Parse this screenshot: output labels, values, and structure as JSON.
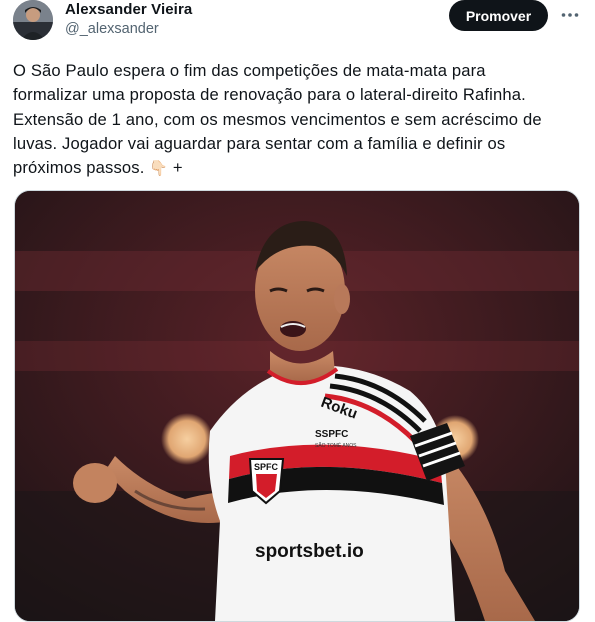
{
  "author": {
    "name": "Alexsander Vieira",
    "handle": "@_alexsander"
  },
  "actions": {
    "promote_label": "Promover",
    "more_icon": "more-horizontal-icon"
  },
  "tweet": {
    "text_lines": [
      "O São Paulo espera o fim das competições de mata-mata para",
      "formalizar uma proposta de renovação para o lateral-direito Rafinha.",
      "Extensão de 1 ano, com os mesmos vencimentos e sem acréscimo de",
      "luvas. Jogador vai aguardar para sentar com a família e definir os"
    ],
    "last_line": "próximos passos.",
    "emoji": "👇🏻",
    "plus": "+"
  },
  "media": {
    "jersey_sponsor": "sportsbet.io",
    "jersey_sleeve": "Roku",
    "jersey_crest": "SPFC",
    "jersey_patch": "SSPFC",
    "jersey_patch_sub": "SÃO TOMÉ ANOS"
  },
  "colors": {
    "text": "#0f1419",
    "secondary": "#536471",
    "button_bg": "#0f1419",
    "button_text": "#ffffff",
    "jersey_red": "#d31d2a",
    "jersey_black": "#111111"
  }
}
